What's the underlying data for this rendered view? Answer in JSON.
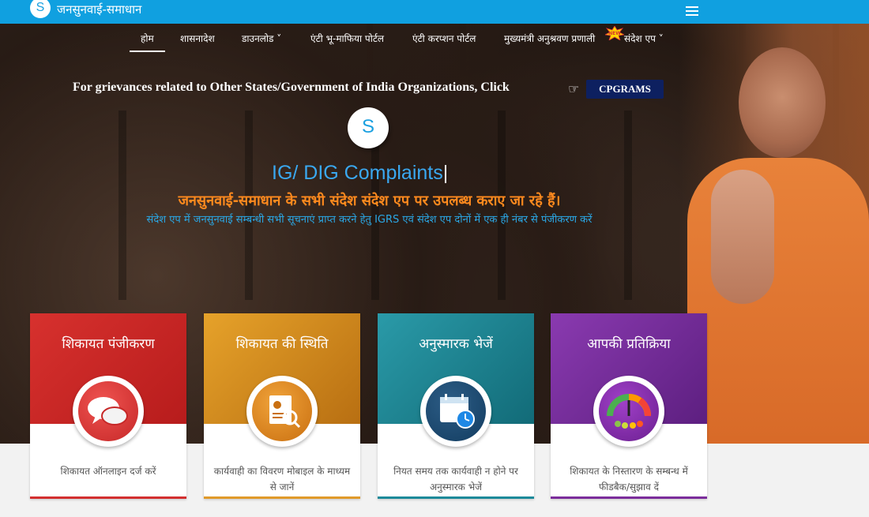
{
  "header": {
    "logo_letter": "S",
    "brand": "जनसुनवाई-समाधान"
  },
  "nav": {
    "items": [
      {
        "label": "होम"
      },
      {
        "label": "शासनादेश"
      },
      {
        "label": "डाउनलोड ˅"
      },
      {
        "label": "एंटी भू-माफिया पोर्टल"
      },
      {
        "label": "एंटी करप्शन पोर्टल"
      },
      {
        "label": "मुख्यमंत्री अनुश्रवण प्रणाली"
      },
      {
        "label": "संदेश एप ˅"
      }
    ],
    "new_badge": "NEW"
  },
  "hero": {
    "grievance_text": "For grievances related to Other States/Government of India Organizations, Click",
    "hand_icon": "☞",
    "cpgrams_label": "CPGRAMS",
    "center_logo_letter": "S",
    "typed_text": "IG/ DIG Complaints",
    "cursor": "|",
    "announcement": "जनसुनवाई-समाधान के सभी संदेश संदेश एप पर उपलब्ध कराए जा रहे हैं।",
    "announcement_sub": "संदेश एप में जनसुनवाई सम्बन्धी सभी सूचनाएं प्राप्त करने हेतु IGRS एवं संदेश एप दोनों में एक ही नंबर से पंजीकरण करें"
  },
  "cards": [
    {
      "title": "शिकायत पंजीकरण",
      "desc": "शिकायत ऑनलाइन दर्ज करें",
      "icon": "chat-bubbles-icon",
      "color": "#c62828"
    },
    {
      "title": "शिकायत की स्थिति",
      "desc": "कार्यवाही का विवरण मोबाइल के माध्यम से जानें",
      "icon": "search-document-icon",
      "color": "#d88a1c"
    },
    {
      "title": "अनुस्मारक भेजें",
      "desc": "नियत समय तक कार्यवाही न होने पर अनुस्मारक भेजें",
      "icon": "calendar-clock-icon",
      "color": "#1d8a9a"
    },
    {
      "title": "आपकी प्रतिक्रिया",
      "desc": "शिकायत के निस्तारण के सम्बन्ध में फीडबैक/सुझाव दें",
      "icon": "feedback-meter-icon",
      "color": "#7b2d9b"
    }
  ]
}
